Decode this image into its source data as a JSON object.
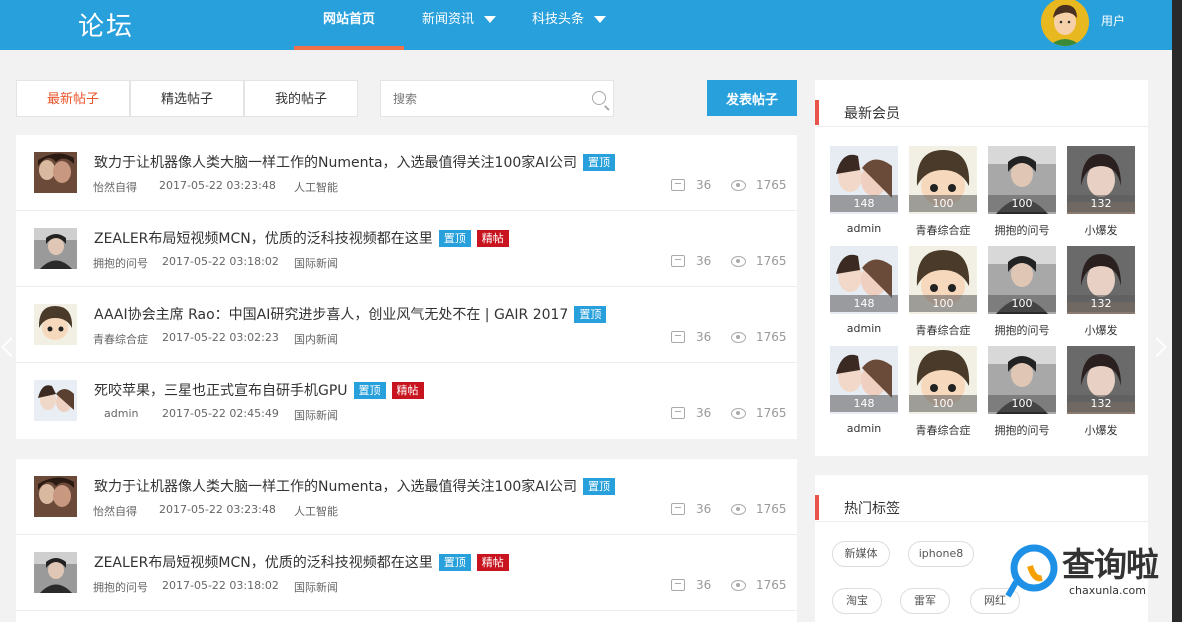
{
  "header": {
    "logo": "论坛",
    "nav": [
      {
        "label": "网站首页",
        "active": true
      },
      {
        "label": "新闻资讯",
        "dropdown": true
      },
      {
        "label": "科技头条",
        "dropdown": true
      }
    ],
    "user_label": "用户"
  },
  "toolbar": {
    "tabs": [
      "最新帖子",
      "精选帖子",
      "我的帖子"
    ],
    "active_tab": "最新帖子",
    "search_placeholder": "搜索",
    "post_button": "发表帖子"
  },
  "badges": {
    "top": "置顶",
    "essence": "精帖"
  },
  "posts_group1": [
    {
      "title": "致力于让机器像人类大脑一样工作的Numenta，入选最值得关注100家AI公司",
      "author": "怡然自得",
      "date": "2017-05-22 03:23:48",
      "category": "人工智能",
      "comments": "36",
      "views": "1765",
      "badges": [
        "置顶"
      ]
    },
    {
      "title": "ZEALER布局短视频MCN，优质的泛科技视频都在这里",
      "author": "拥抱的问号",
      "date": "2017-05-22 03:18:02",
      "category": "国际新闻",
      "comments": "36",
      "views": "1765",
      "badges": [
        "置顶",
        "精帖"
      ]
    },
    {
      "title": "AAAI协会主席 Rao：中国AI研究进步喜人，创业风气无处不在 | GAIR 2017",
      "author": "青春综合症",
      "date": "2017-05-22 03:02:23",
      "category": "国内新闻",
      "comments": "36",
      "views": "1765",
      "badges": [
        "置顶"
      ]
    },
    {
      "title": "死咬苹果，三星也正式宣布自研手机GPU",
      "author": "admin",
      "date": "2017-05-22 02:45:49",
      "category": "国际新闻",
      "comments": "36",
      "views": "1765",
      "badges": [
        "置顶",
        "精帖"
      ]
    }
  ],
  "posts_group2": [
    {
      "title": "致力于让机器像人类大脑一样工作的Numenta，入选最值得关注100家AI公司",
      "author": "怡然自得",
      "date": "2017-05-22 03:23:48",
      "category": "人工智能",
      "comments": "36",
      "views": "1765",
      "badges": [
        "置顶"
      ]
    },
    {
      "title": "ZEALER布局短视频MCN，优质的泛科技视频都在这里",
      "author": "拥抱的问号",
      "date": "2017-05-22 03:18:02",
      "category": "国际新闻",
      "comments": "36",
      "views": "1765",
      "badges": [
        "置顶",
        "精帖"
      ]
    }
  ],
  "new_members": {
    "title": "最新会员",
    "rows": [
      [
        {
          "name": "admin",
          "count": "148"
        },
        {
          "name": "青春综合症",
          "count": "100"
        },
        {
          "name": "拥抱的问号",
          "count": "100"
        },
        {
          "name": "小爆发",
          "count": "132"
        }
      ],
      [
        {
          "name": "admin",
          "count": "148"
        },
        {
          "name": "青春综合症",
          "count": "100"
        },
        {
          "name": "拥抱的问号",
          "count": "100"
        },
        {
          "name": "小爆发",
          "count": "132"
        }
      ],
      [
        {
          "name": "admin",
          "count": "148"
        },
        {
          "name": "青春综合症",
          "count": "100"
        },
        {
          "name": "拥抱的问号",
          "count": "100"
        },
        {
          "name": "小爆发",
          "count": "132"
        }
      ]
    ]
  },
  "hot_tags": {
    "title": "热门标签",
    "tags": [
      "新媒体",
      "iphone8",
      "淘宝",
      "雷军",
      "网红"
    ]
  },
  "watermark": {
    "text": "查询啦",
    "url": "chaxunla.com"
  },
  "colors": {
    "header": "#28a0dc",
    "accent": "#e8542a",
    "badge_top": "#28a0dc",
    "badge_essence": "#c8141e"
  }
}
